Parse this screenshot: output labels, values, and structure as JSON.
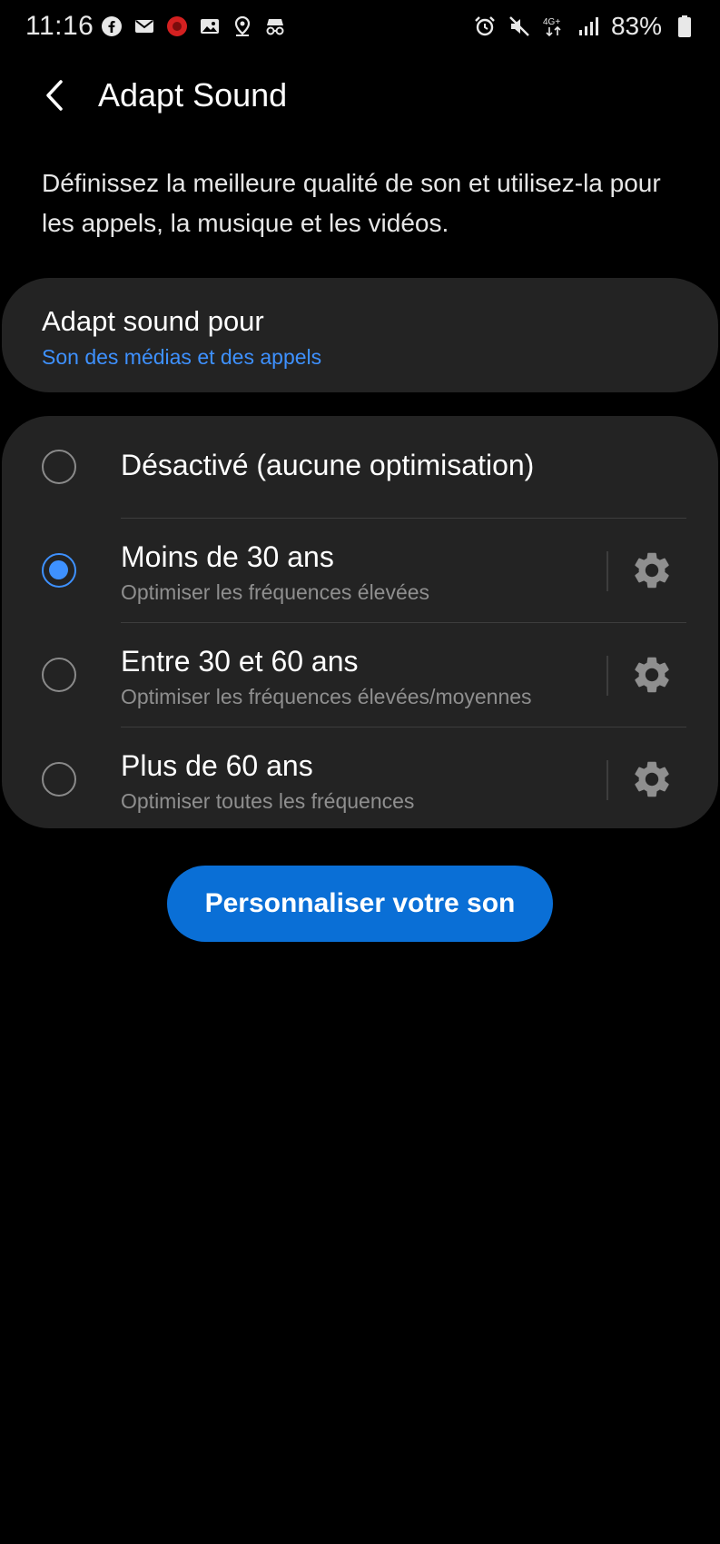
{
  "status_bar": {
    "time": "11:16",
    "left_icons": [
      "facebook-icon",
      "mail-icon",
      "red-app-icon",
      "image-icon",
      "location-icon",
      "incognito-icon"
    ],
    "right_icons": [
      "alarm-icon",
      "mute-icon",
      "4g-icon",
      "signal-icon"
    ],
    "network_label": "4G+",
    "battery": "83%"
  },
  "header": {
    "title": "Adapt Sound"
  },
  "description": "Définissez la meilleure qualité de son et utilisez-la pour les appels, la musique et les vidéos.",
  "target": {
    "title": "Adapt sound pour",
    "value": "Son des médias et des appels"
  },
  "options": [
    {
      "title": "Désactivé (aucune optimisation)",
      "subtitle": "",
      "selected": false,
      "has_settings": false
    },
    {
      "title": "Moins de 30 ans",
      "subtitle": "Optimiser les fréquences élevées",
      "selected": true,
      "has_settings": true
    },
    {
      "title": "Entre 30 et 60 ans",
      "subtitle": "Optimiser les fréquences élevées/moyennes",
      "selected": false,
      "has_settings": true
    },
    {
      "title": "Plus de 60 ans",
      "subtitle": "Optimiser toutes les fréquences",
      "selected": false,
      "has_settings": true
    }
  ],
  "customize_button": {
    "label": "Personnaliser votre son"
  },
  "colors": {
    "accent": "#3e91ff",
    "button": "#0a6fd6",
    "card": "#232323",
    "background": "#000000"
  }
}
